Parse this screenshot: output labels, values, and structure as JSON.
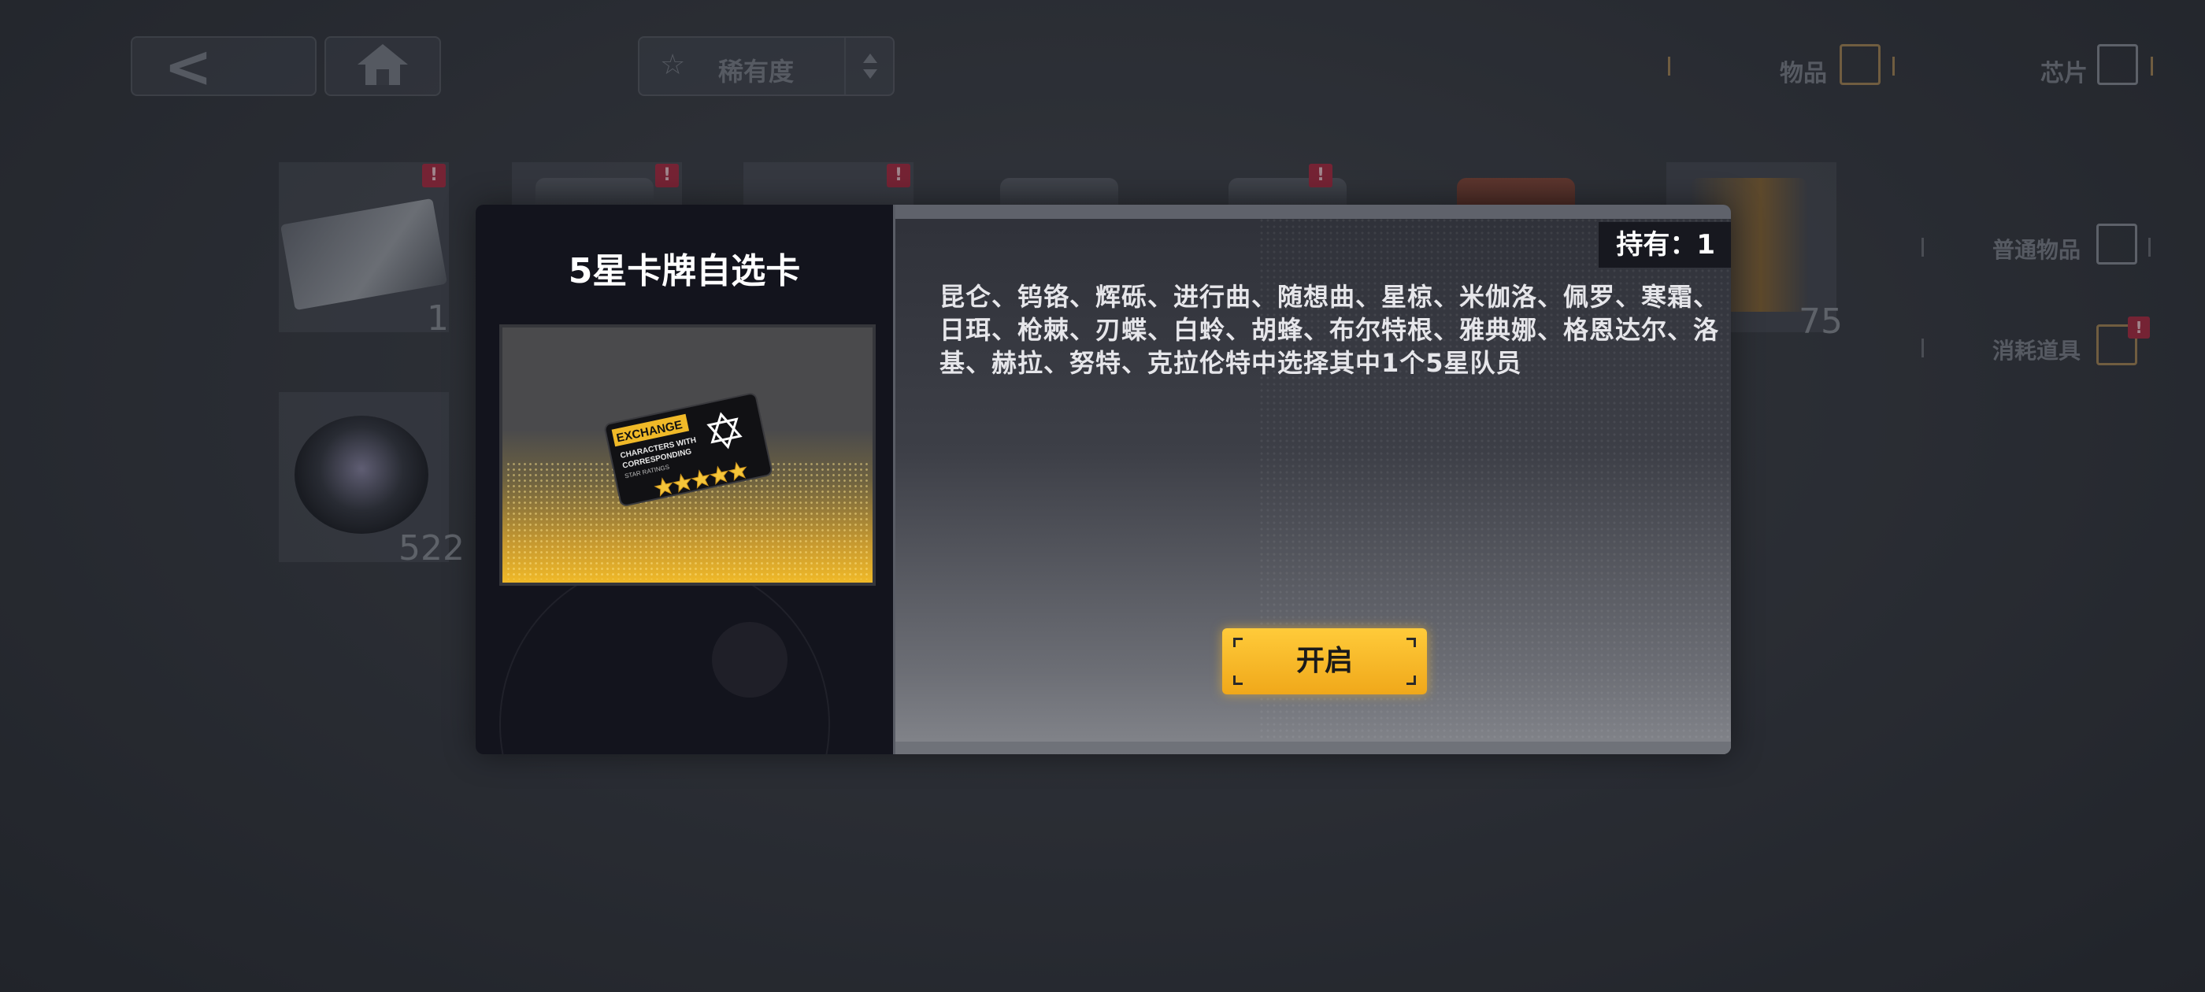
{
  "topbar": {
    "back_icon": "chevron-left-icon",
    "back_glyph": "<",
    "home_icon": "home-icon",
    "sort": {
      "icon": "star-icon",
      "star_glyph": "☆",
      "label": "稀有度"
    },
    "tabs": [
      {
        "label": "物品",
        "icon": "item-icon"
      },
      {
        "label": "芯片",
        "icon": "chip-icon"
      }
    ]
  },
  "side_tabs": [
    {
      "label": "普通物品",
      "icon": "normal-item-icon"
    },
    {
      "label": "消耗道具",
      "icon": "consumable-icon",
      "badge": "!"
    }
  ],
  "inventory": {
    "slots": [
      {
        "badge": "!",
        "count": "1"
      },
      {
        "badge": "!",
        "count": ""
      },
      {
        "badge": "!",
        "count": ""
      },
      {
        "badge": "",
        "count": ""
      },
      {
        "badge": "!",
        "count": ""
      },
      {
        "badge": "",
        "count": ""
      },
      {
        "badge": "",
        "count": "75"
      },
      {
        "badge": "",
        "count": "522"
      }
    ]
  },
  "modal": {
    "item_name": "5星卡牌自选卡",
    "card_text": {
      "exchange": "EXCHANGE",
      "line1": "CHARACTERS WITH",
      "line2": "CORRESPONDING",
      "line3": "STAR RATINGS"
    },
    "owned_label": "持有：",
    "owned_value": "1",
    "description": "昆仑、钨铬、辉砾、进行曲、随想曲、星椋、米伽洛、佩罗、寒霜、日珥、枪棘、刃蝶、白蛉、胡蜂、布尔特根、雅典娜、格恩达尔、洛基、赫拉、努特、克拉伦特中选择其中1个5星队员",
    "open_button": "开启"
  },
  "colors": {
    "accent": "#f0b928",
    "badge": "#b03048",
    "modal_left": "#13141d"
  }
}
